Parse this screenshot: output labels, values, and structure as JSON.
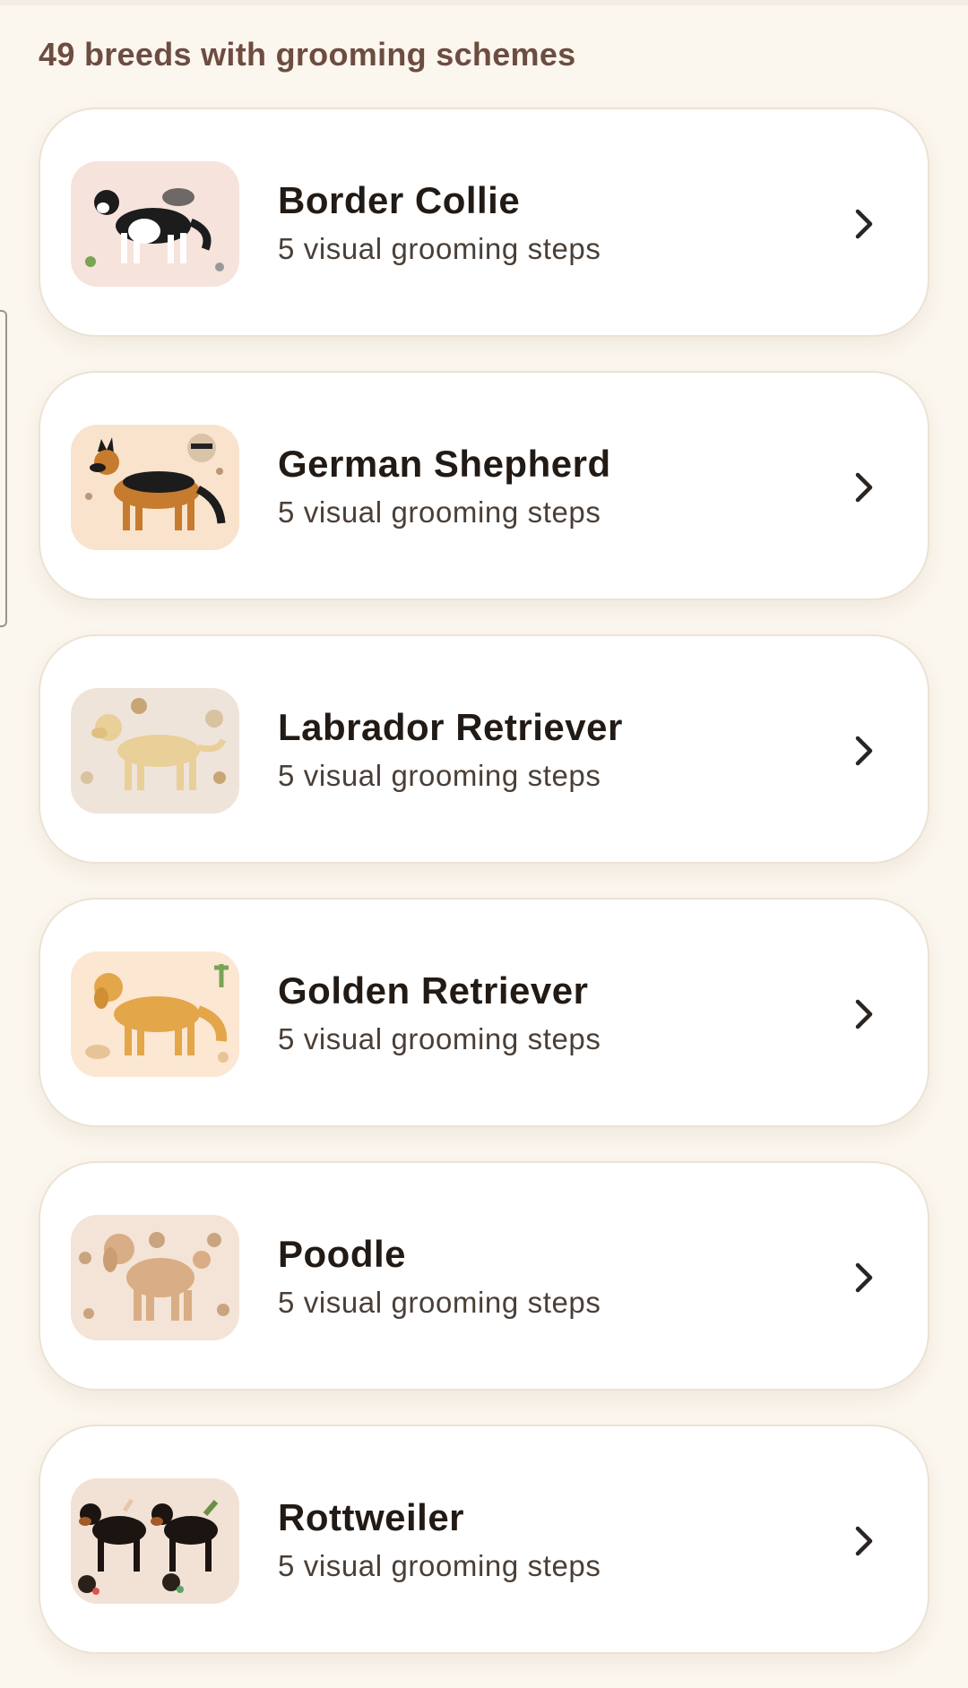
{
  "header": {
    "count_label": "49 breeds with grooming schemes"
  },
  "breeds": [
    {
      "name": "Border Collie",
      "steps": "5 visual grooming steps",
      "thumb_icon": "border-collie-illustration",
      "thumb_bg": "#f6e3dc",
      "coat": "#1c1c1c",
      "accent": "#ffffff"
    },
    {
      "name": "German Shepherd",
      "steps": "5 visual grooming steps",
      "thumb_icon": "german-shepherd-illustration",
      "thumb_bg": "#f9e3cc",
      "coat": "#c67b2e",
      "accent": "#1c1c1c"
    },
    {
      "name": "Labrador Retriever",
      "steps": "5 visual grooming steps",
      "thumb_icon": "labrador-retriever-illustration",
      "thumb_bg": "#efe4da",
      "coat": "#e9cf98",
      "accent": "#e9cf98"
    },
    {
      "name": "Golden Retriever",
      "steps": "5 visual grooming steps",
      "thumb_icon": "golden-retriever-illustration",
      "thumb_bg": "#fbe7d2",
      "coat": "#e3a649",
      "accent": "#e3a649"
    },
    {
      "name": "Poodle",
      "steps": "5 visual grooming steps",
      "thumb_icon": "poodle-illustration",
      "thumb_bg": "#f4e3d7",
      "coat": "#d9ad85",
      "accent": "#d9ad85"
    },
    {
      "name": "Rottweiler",
      "steps": "5 visual grooming steps",
      "thumb_icon": "rottweiler-illustration",
      "thumb_bg": "#f2e2d6",
      "coat": "#1b1410",
      "accent": "#a45a25"
    }
  ],
  "icons": {
    "chevron": "chevron-right-icon"
  }
}
